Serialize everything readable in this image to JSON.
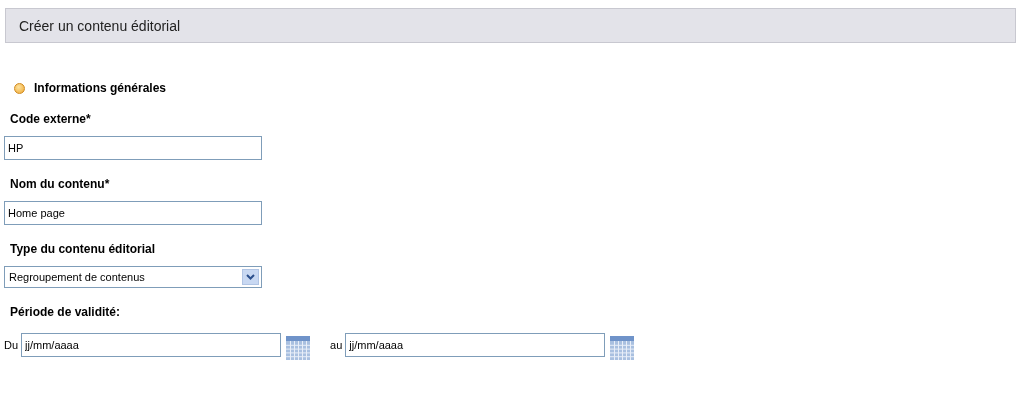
{
  "header": {
    "title": "Créer un contenu éditorial"
  },
  "section": {
    "title": "Informations générales"
  },
  "fields": [
    {
      "kind": "text",
      "label": "Code externe*",
      "value": "HP"
    },
    {
      "kind": "text",
      "label": "Nom du contenu*",
      "value": "Home page"
    },
    {
      "kind": "select",
      "label": "Type du contenu éditorial",
      "value": "Regroupement de contenus"
    },
    {
      "kind": "daterange",
      "label": "Période de validité:",
      "from_label": "Du",
      "from_value": "jj/mm/aaaa",
      "to_label": "au",
      "to_value": "jj/mm/aaaa"
    }
  ]
}
